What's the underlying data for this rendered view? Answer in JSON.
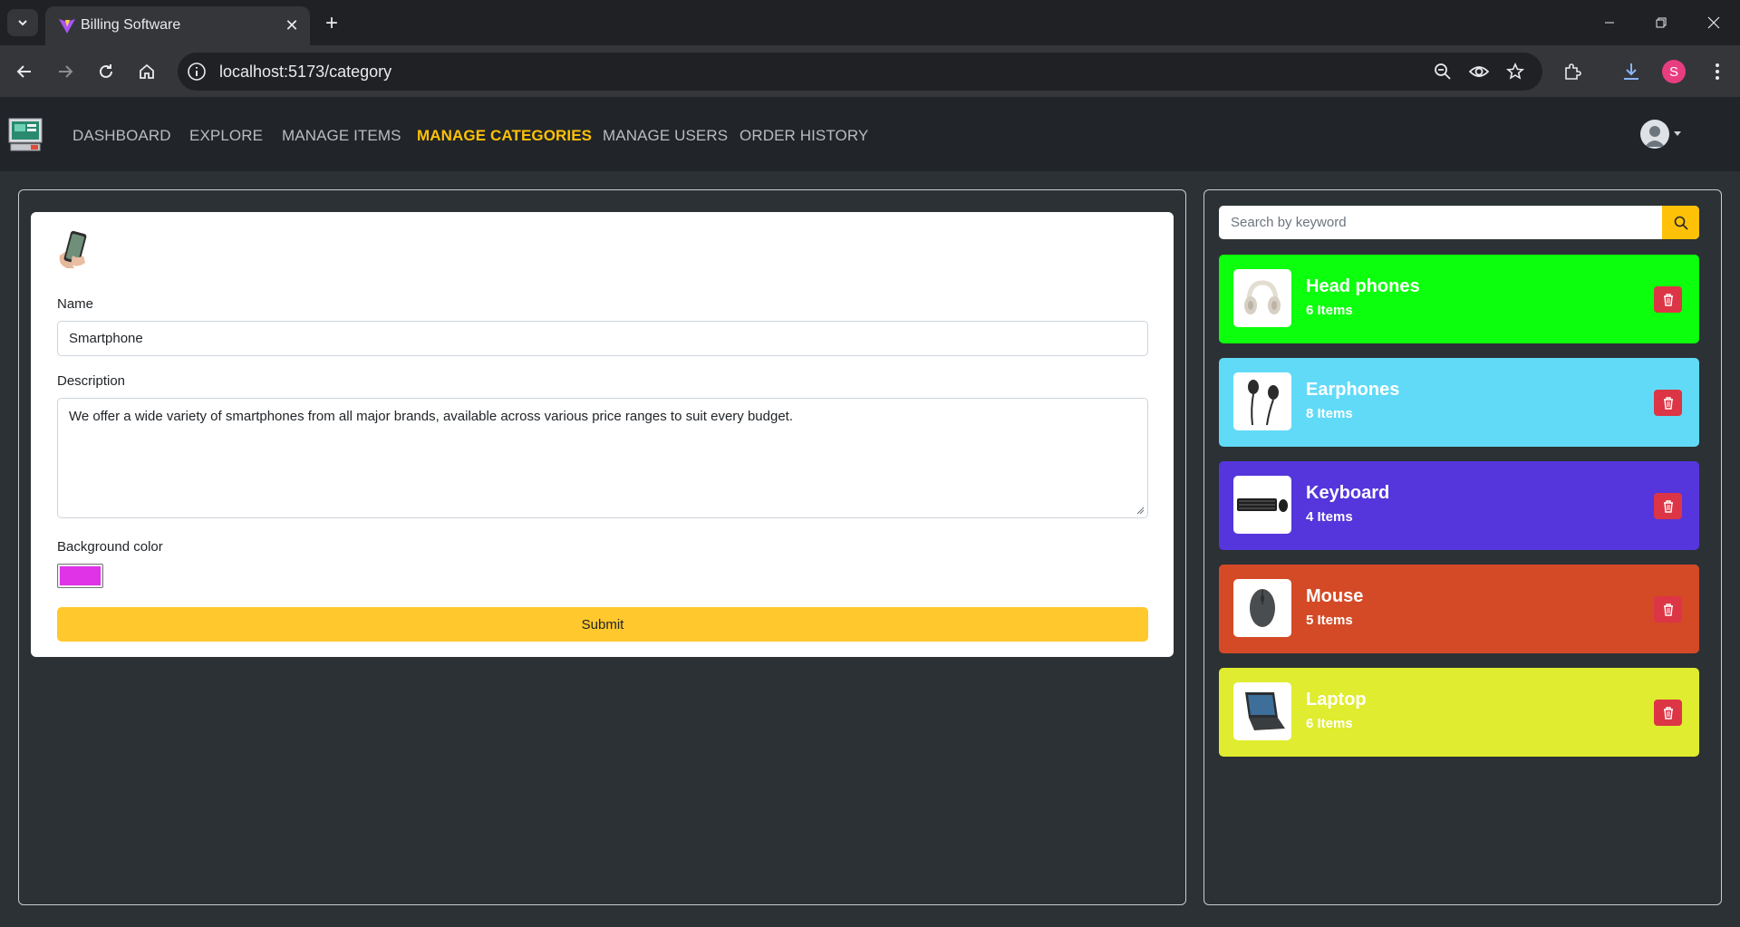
{
  "browser": {
    "tab_title": "Billing Software",
    "url": "localhost:5173/category",
    "profile_initial": "S"
  },
  "nav": {
    "links": [
      {
        "label": "Dashboard",
        "active": false
      },
      {
        "label": "Explore",
        "active": false
      },
      {
        "label": "Manage Items",
        "active": false
      },
      {
        "label": "Manage Categories",
        "active": true
      },
      {
        "label": "Manage Users",
        "active": false
      },
      {
        "label": "Order History",
        "active": false
      }
    ]
  },
  "form": {
    "image_icon": "smartphone-image",
    "name_label": "Name",
    "name_value": "Smartphone",
    "description_label": "Description",
    "description_value": "We offer a wide variety of smartphones from all major brands, available across various price ranges to suit every budget.",
    "bgcolor_label": "Background color",
    "bgcolor_value": "#e033e8",
    "submit_label": "Submit"
  },
  "search": {
    "placeholder": "Search by keyword"
  },
  "categories": [
    {
      "name": "Head phones",
      "count": "6 Items",
      "color": "#0cff0c",
      "icon": "headphones-image"
    },
    {
      "name": "Earphones",
      "count": "8 Items",
      "color": "#61daf7",
      "icon": "earphones-image"
    },
    {
      "name": "Keyboard",
      "count": "4 Items",
      "color": "#5436dc",
      "icon": "keyboard-image"
    },
    {
      "name": "Mouse",
      "count": "5 Items",
      "color": "#d44a26",
      "icon": "mouse-image"
    },
    {
      "name": "Laptop",
      "count": "6 Items",
      "color": "#dfec2f",
      "icon": "laptop-image"
    }
  ],
  "colors": {
    "accent": "#ffc107",
    "danger": "#dc3545",
    "page_bg": "#2b3134",
    "navbar_bg": "#212529"
  }
}
